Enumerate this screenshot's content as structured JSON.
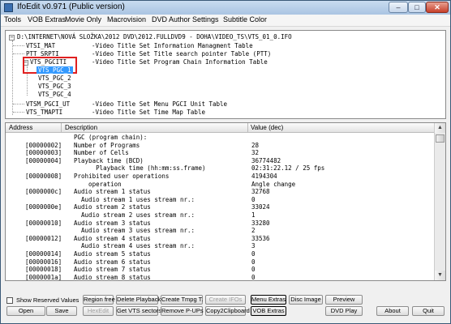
{
  "window": {
    "title": "IfoEdit v0.971 (Public version)",
    "min_glyph": "–",
    "max_glyph": "□",
    "close_glyph": "✕"
  },
  "menu": [
    "Tools",
    "VOB Extras",
    "Movie Only",
    "Macrovision",
    "DVD Author",
    "Settings",
    "Subtitle Color"
  ],
  "tree": {
    "root": "D:\\INTERNET\\NOVÁ SLOŽKA\\2012 DVD\\2012.FULLDVD9 - DOHA\\VIDEO_TS\\VTS_01_0.IFO",
    "items": [
      {
        "label": "VTSI_MAT",
        "desc": "-Video Title Set Information Managment Table"
      },
      {
        "label": "PTT_SRPTI",
        "desc": "-Video Title Set Title search pointer Table (PTT)"
      },
      {
        "label": "VTS_PGCITI",
        "desc": "-Video Title Set Program Chain Information Table"
      },
      {
        "label": "VTS_PGC_1",
        "desc": ""
      },
      {
        "label": "VTS_PGC_2",
        "desc": ""
      },
      {
        "label": "VTS_PGC_3",
        "desc": ""
      },
      {
        "label": "VTS_PGC_4",
        "desc": ""
      },
      {
        "label": "VTSM_PGCI_UT",
        "desc": "-Video Title Set Menu PGCI Unit Table"
      },
      {
        "label": "VTS_TMAPTI",
        "desc": "-Video Title Set Time Map Table"
      }
    ],
    "collapse_glyph": "−",
    "expand_glyph": "+"
  },
  "table": {
    "headers": [
      "Address",
      "Description",
      "Value (dec)"
    ],
    "rows": [
      {
        "addr": "",
        "desc": "PGC (program chain):",
        "val": ""
      },
      {
        "addr": "[00000002]",
        "desc": "Number of Programs",
        "val": "28"
      },
      {
        "addr": "[00000003]",
        "desc": "Number of Cells",
        "val": "32"
      },
      {
        "addr": "[00000004]",
        "desc": "Playback time (BCD)",
        "val": "36774482"
      },
      {
        "addr": "",
        "desc": "      Playback time (hh:mm:ss.frame)",
        "val": "02:31:22.12 / 25 fps"
      },
      {
        "addr": "[00000008]",
        "desc": "Prohibited user operations",
        "val": "4194304"
      },
      {
        "addr": "",
        "desc": "    operation",
        "val": "Angle change"
      },
      {
        "addr": "[0000000c]",
        "desc": "Audio stream 1 status",
        "val": "32768"
      },
      {
        "addr": "",
        "desc": "  Audio stream 1 uses stream nr.:",
        "val": "0"
      },
      {
        "addr": "[0000000e]",
        "desc": "Audio stream 2 status",
        "val": "33024"
      },
      {
        "addr": "",
        "desc": "  Audio stream 2 uses stream nr.:",
        "val": "1"
      },
      {
        "addr": "[00000010]",
        "desc": "Audio stream 3 status",
        "val": "33280"
      },
      {
        "addr": "",
        "desc": "  Audio stream 3 uses stream nr.:",
        "val": "2"
      },
      {
        "addr": "[00000012]",
        "desc": "Audio stream 4 status",
        "val": "33536"
      },
      {
        "addr": "",
        "desc": "  Audio stream 4 uses stream nr.:",
        "val": "3"
      },
      {
        "addr": "[00000014]",
        "desc": "Audio stream 5 status",
        "val": "0"
      },
      {
        "addr": "[00000016]",
        "desc": "Audio stream 6 status",
        "val": "0"
      },
      {
        "addr": "[00000018]",
        "desc": "Audio stream 7 status",
        "val": "0"
      },
      {
        "addr": "[0000001a]",
        "desc": "Audio stream 8 status",
        "val": "0"
      }
    ],
    "scroll_up_glyph": "▲",
    "scroll_down_glyph": "▼"
  },
  "controls": {
    "show_reserved_label": "Show Reserved Values",
    "show_reserved_checked": false,
    "buttons": {
      "open": "Open",
      "save": "Save",
      "region_free": "Region free",
      "hexedit": "HexEdit",
      "delete_playback": "Delete Playback",
      "get_vts_sectors": "Get VTS sectors",
      "create_tmpg": "Create Tmpg T.",
      "remove_pups": "Remove P-UPs",
      "create_ifos": "Create IFOs",
      "copy2clipboard": "Copy2Clipboard",
      "menu_extras": "Menu Extras",
      "vob_extras": "VOB Extras",
      "disc_image": "Disc Image",
      "preview": "Preview",
      "dvd_play": "DVD Play",
      "about": "About",
      "quit": "Quit"
    }
  }
}
